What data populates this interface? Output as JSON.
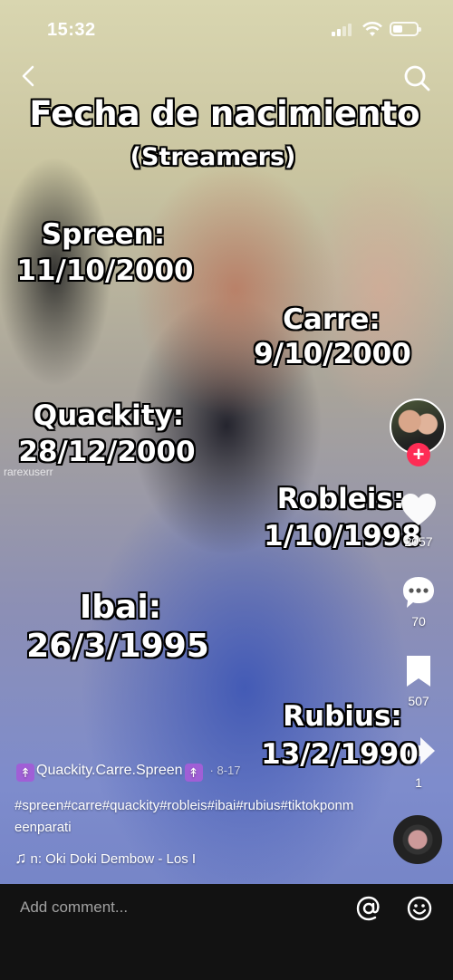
{
  "status_bar": {
    "time": "15:32"
  },
  "overlay": {
    "title": "Fecha de nacimiento",
    "subtitle": "(Streamers)",
    "entries": [
      {
        "name": "Spreen:",
        "date": "11/10/2000"
      },
      {
        "name": "Carre:",
        "date": "9/10/2000"
      },
      {
        "name": "Quackity:",
        "date": "28/12/2000"
      },
      {
        "name": "Robleis:",
        "date": "1/10/1998"
      },
      {
        "name": "Ibai:",
        "date": "26/3/1995"
      },
      {
        "name": "Rubius:",
        "date": "13/2/1990"
      }
    ],
    "watermark": "rarexuserr"
  },
  "actions": {
    "follow_symbol": "+",
    "likes": "2057",
    "comments": "70",
    "saves": "507",
    "shares": "1"
  },
  "caption": {
    "username": "Quackity.Carre.Spreen",
    "date": "· 8-17",
    "hashtags": "#spreen#carre#quackity#robleis#ibai#rubius#tiktokponmeenparati",
    "music": "n: Oki Doki Dembow - Los I"
  },
  "bottom_bar": {
    "comment_placeholder": "Add comment..."
  },
  "icons": {
    "back": "chevron-left-icon",
    "search": "search-icon",
    "like": "heart-icon",
    "comment": "comment-icon",
    "save": "bookmark-icon",
    "share": "share-icon",
    "music": "music-note-icon",
    "mention": "at-icon",
    "emoji": "emoji-icon"
  },
  "colors": {
    "follow_button": "#fe2c55",
    "bottom_bar": "#121212"
  }
}
